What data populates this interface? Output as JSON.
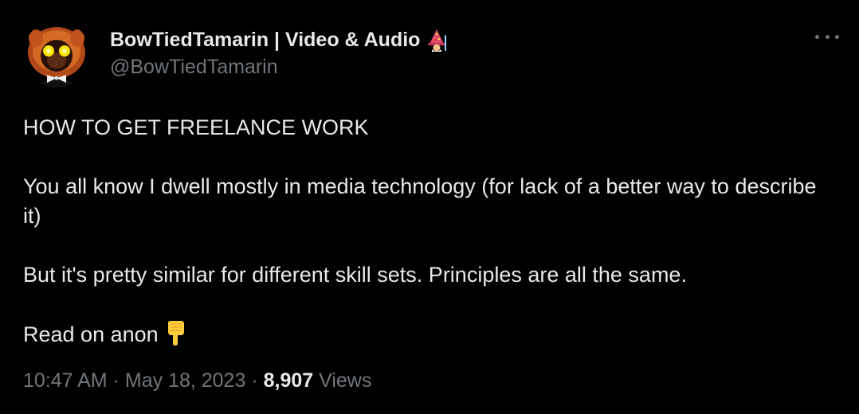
{
  "author": {
    "display_name": "BowTiedTamarin | Video & Audio",
    "handle": "@BowTiedTamarin",
    "name_emoji": "wizard-emoji",
    "avatar": "tamarin-avatar"
  },
  "menu": {
    "icon": "more-horizontal-icon"
  },
  "tweet": {
    "line1": "HOW TO GET FREELANCE WORK",
    "line2": "You all know I dwell mostly in media technology (for lack of a better way to describe it)",
    "line3": "But it's pretty similar for different skill sets. Principles are all the same.",
    "line4": "Read on anon",
    "line4_emoji": "pointing-down-emoji"
  },
  "meta": {
    "time": "10:47 AM",
    "separator": "·",
    "date": "May 18, 2023",
    "views_count": "8,907",
    "views_label": "Views"
  },
  "colors": {
    "background": "#000000",
    "text_primary": "#e7e9ea",
    "text_secondary": "#71767b"
  }
}
